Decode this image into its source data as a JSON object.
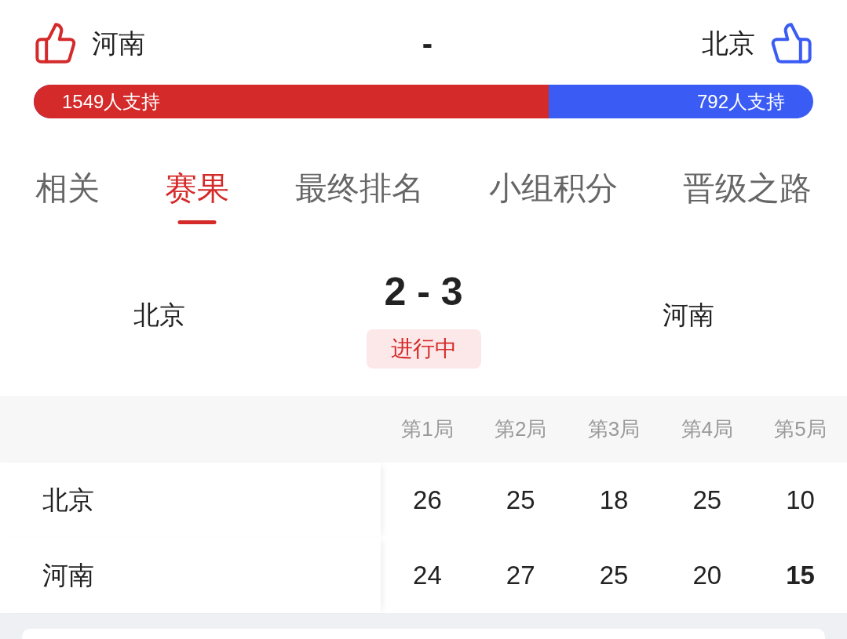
{
  "teams": [
    {
      "name": "河南",
      "color": "#d42a2a"
    },
    {
      "name": "北京",
      "color": "#3a5cf5"
    }
  ],
  "separator": "-",
  "support_bar": {
    "level": 0.661,
    "labels": [
      "1549人支持",
      "792人支持"
    ]
  },
  "tabs": [
    {
      "label": "相关",
      "selected": false
    },
    {
      "label": "赛果",
      "selected": true
    },
    {
      "label": "最终排名",
      "selected": false
    },
    {
      "label": "小组积分",
      "selected": false
    },
    {
      "label": "晋级之路",
      "selected": false
    }
  ],
  "result": {
    "left_team": "北京",
    "score": "2 - 3",
    "status": "进行中",
    "right_team": "河南"
  },
  "sets_table": {
    "columns": [
      "第1局",
      "第2局",
      "第3局",
      "第4局",
      "第5局"
    ],
    "rows": [
      {
        "team": "北京",
        "scores": [
          {
            "value": "26",
            "bold": false
          },
          {
            "value": "25",
            "bold": false
          },
          {
            "value": "18",
            "bold": false
          },
          {
            "value": "25",
            "bold": false
          },
          {
            "value": "10",
            "bold": false
          }
        ]
      },
      {
        "team": "河南",
        "scores": [
          {
            "value": "24",
            "bold": false
          },
          {
            "value": "27",
            "bold": false
          },
          {
            "value": "25",
            "bold": false
          },
          {
            "value": "20",
            "bold": false
          },
          {
            "value": "15",
            "bold": true
          }
        ]
      }
    ]
  }
}
